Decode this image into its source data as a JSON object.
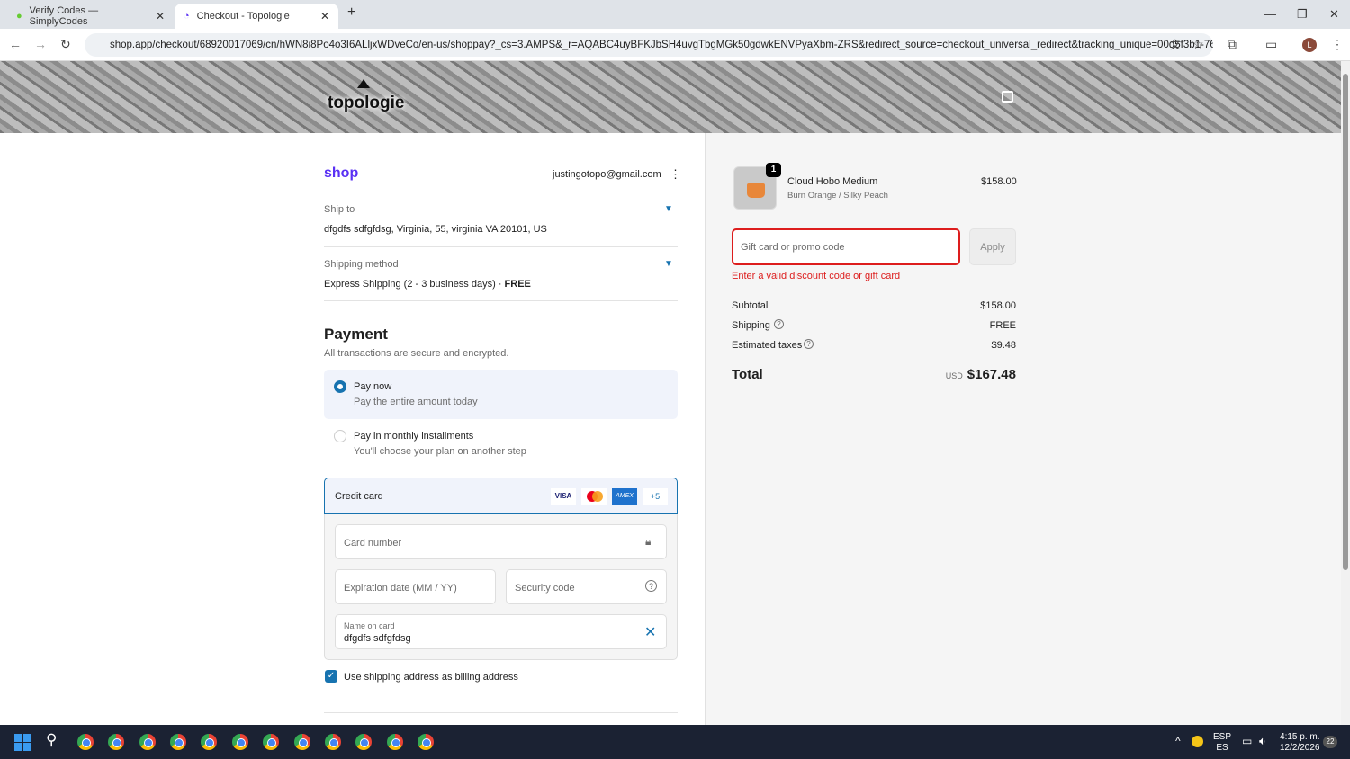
{
  "browser": {
    "tabs": [
      {
        "label": "Verify Codes — SimplyCodes"
      },
      {
        "label": "Checkout - Topologie"
      }
    ],
    "url": "shop.app/checkout/68920017069/cn/hWN8i8Po4o3I6ALljxWDveCo/en-us/shoppay?_cs=3.AMPS&_r=AQABC4uyBFKJbSH4uvgTbgMGk50gdwkENVPyaXbm-ZRS&redirect_source=checkout_universal_redirect&tracking_unique=00d5f3b1-764f...",
    "profile_initial": "L"
  },
  "header": {
    "logo": "topologie"
  },
  "checkout": {
    "shop_logo": "shop",
    "email": "justingotopo@gmail.com",
    "ship_to_label": "Ship to",
    "ship_to_value": "dfgdfs sdfgfdsg, Virginia, 55, virginia VA 20101, US",
    "shipping_method_label": "Shipping method",
    "shipping_method_value": "Express Shipping (2 - 3 business days) · ",
    "shipping_method_price": "FREE",
    "payment_title": "Payment",
    "payment_subtitle": "All transactions are secure and encrypted.",
    "options": [
      {
        "title": "Pay now",
        "subtitle": "Pay the entire amount today",
        "selected": true
      },
      {
        "title": "Pay in monthly installments",
        "subtitle": "You'll choose your plan on another step",
        "selected": false
      }
    ],
    "credit_card_label": "Credit card",
    "card_brands": [
      "VISA",
      "AMEX",
      "+5"
    ],
    "card_number_placeholder": "Card number",
    "expiry_placeholder": "Expiration date (MM / YY)",
    "security_placeholder": "Security code",
    "name_label": "Name on card",
    "name_value": "dfgdfs sdfgfdsg",
    "billing_checkbox": "Use shipping address as billing address",
    "billing_checked": true
  },
  "summary": {
    "item": {
      "qty": "1",
      "name": "Cloud Hobo Medium",
      "variant": "Burn Orange / Silky Peach",
      "price": "$158.00"
    },
    "promo_placeholder": "Gift card or promo code",
    "apply": "Apply",
    "error": "Enter a valid discount code or gift card",
    "subtotal_label": "Subtotal",
    "subtotal": "$158.00",
    "shipping_label": "Shipping",
    "shipping": "FREE",
    "taxes_label": "Estimated taxes",
    "taxes": "$9.48",
    "total_label": "Total",
    "currency": "USD",
    "total": "$167.48"
  },
  "taskbar": {
    "lang1": "ESP",
    "lang2": "ES",
    "time": "4:15 p. m.",
    "date": "12/2/2026",
    "notifications": "22"
  },
  "colors": {
    "accent": "#1773b0",
    "error": "#dd1d1d",
    "taskbar": "#1b2233"
  }
}
